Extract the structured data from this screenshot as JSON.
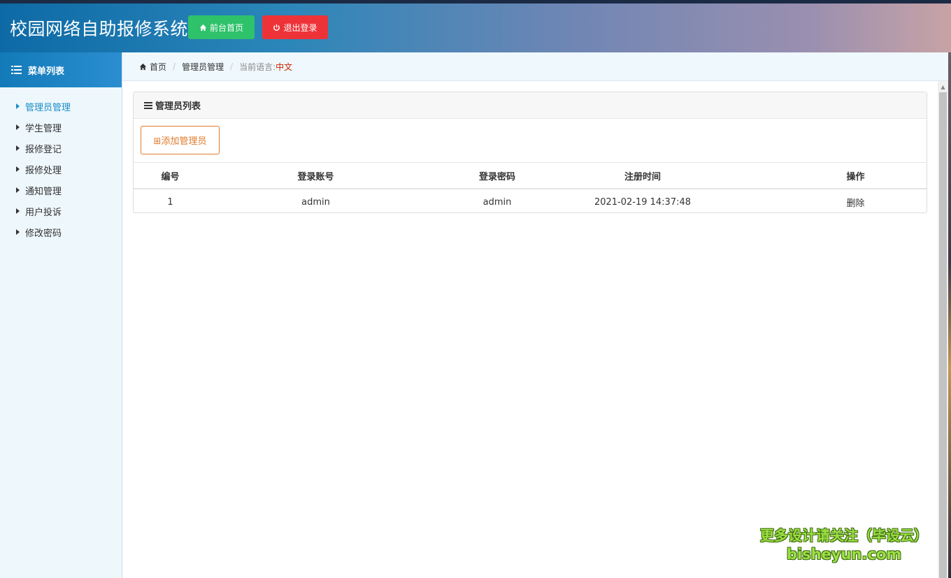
{
  "header": {
    "title": "校园网络自助报修系统",
    "home_button": "前台首页",
    "logout_button": "退出登录"
  },
  "sidebar": {
    "heading": "菜单列表",
    "items": [
      {
        "label": "管理员管理",
        "active": true
      },
      {
        "label": "学生管理"
      },
      {
        "label": "报修登记"
      },
      {
        "label": "报修处理"
      },
      {
        "label": "通知管理"
      },
      {
        "label": "用户投诉"
      },
      {
        "label": "修改密码"
      }
    ]
  },
  "breadcrumb": {
    "home": "首页",
    "current": "管理员管理",
    "lang_label": "当前语言:",
    "lang_value": "中文"
  },
  "panel": {
    "title": "管理员列表",
    "add_button": "⊞添加管理员",
    "columns": [
      "编号",
      "登录账号",
      "登录密码",
      "注册时间",
      "操作"
    ],
    "rows": [
      {
        "id": "1",
        "account": "admin",
        "password": "admin",
        "registered": "2021-02-19 14:37:48",
        "action": "删除"
      }
    ]
  },
  "watermark": {
    "line1": "更多设计请关注（毕设云）",
    "line2": "bisheyun.com"
  },
  "colors": {
    "accent": "#1a8ec7",
    "home_btn": "#2ec26a",
    "logout_btn": "#ee3338",
    "add_btn": "#e07a2b",
    "lang_value": "#cc2200"
  }
}
